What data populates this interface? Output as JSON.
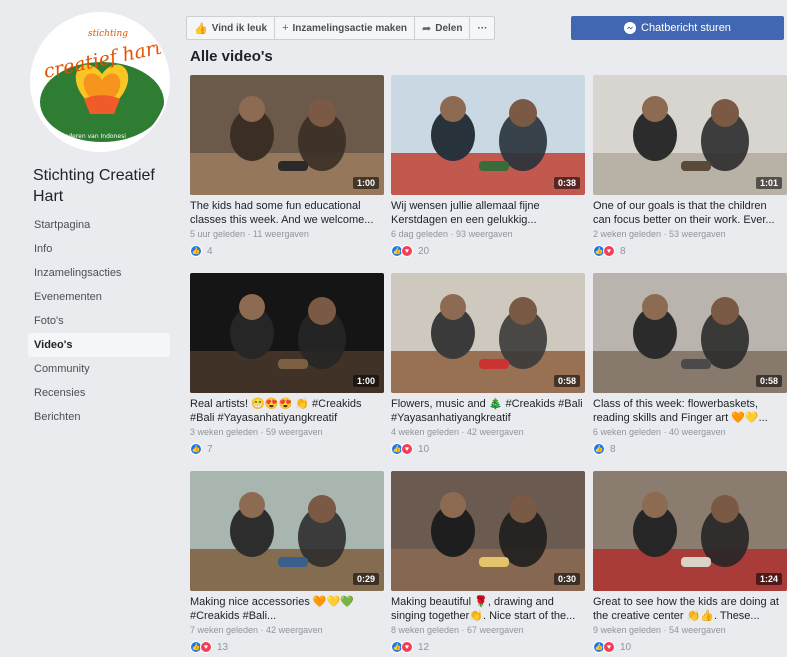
{
  "page": {
    "logo_text_top": "stichting",
    "logo_text_main": "creatief hart",
    "logo_text_bottom": "de kinderen van Indonesi",
    "name": "Stichting Creatief Hart"
  },
  "sidebar": {
    "items": [
      {
        "label": "Startpagina",
        "active": false
      },
      {
        "label": "Info",
        "active": false
      },
      {
        "label": "Inzamelingsacties",
        "active": false
      },
      {
        "label": "Evenementen",
        "active": false
      },
      {
        "label": "Foto's",
        "active": false
      },
      {
        "label": "Video's",
        "active": true
      },
      {
        "label": "Community",
        "active": false
      },
      {
        "label": "Recensies",
        "active": false
      },
      {
        "label": "Berichten",
        "active": false
      }
    ]
  },
  "actions": {
    "like": "Vind ik leuk",
    "fundraiser": "Inzamelingsactie maken",
    "share": "Delen",
    "more": "···",
    "message": "Chatbericht sturen"
  },
  "section_title": "Alle video's",
  "colors": {
    "accent": "#4267b2",
    "like": "#1877f2",
    "love": "#f33e58"
  },
  "videos": [
    {
      "duration": "1:00",
      "title": "The kids had some fun educational classes this week. And we welcome...",
      "meta": "5 uur geleden · 11 weergaven",
      "reactions": [
        "like"
      ],
      "count": "4"
    },
    {
      "duration": "0:38",
      "title": "Wij wensen jullie allemaal fijne Kerstdagen en een gelukkig...",
      "meta": "6 dag geleden · 93 weergaven",
      "reactions": [
        "like",
        "love"
      ],
      "count": "20"
    },
    {
      "duration": "1:01",
      "title": "One of our goals is that the children can focus better on their work. Ever...",
      "meta": "2 weken geleden · 53 weergaven",
      "reactions": [
        "like",
        "love"
      ],
      "count": "8"
    },
    {
      "duration": "1:00",
      "title": "Real artists! 😁😍😍 👏 #Creakids #Bali #Yayasanhatiyangkreatif",
      "meta": "3 weken geleden · 59 weergaven",
      "reactions": [
        "like"
      ],
      "count": "7"
    },
    {
      "duration": "0:58",
      "title": "Flowers, music and 🎄 #Creakids #Bali #Yayasanhatiyangkreatif",
      "meta": "4 weken geleden · 42 weergaven",
      "reactions": [
        "like",
        "love"
      ],
      "count": "10"
    },
    {
      "duration": "0:58",
      "title": "Class of this week: flowerbaskets, reading skills and Finger art 🧡💛...",
      "meta": "6 weken geleden · 40 weergaven",
      "reactions": [
        "like"
      ],
      "count": "8"
    },
    {
      "duration": "0:29",
      "title": "Making nice accessories 🧡💛💚 #Creakids #Bali...",
      "meta": "7 weken geleden · 42 weergaven",
      "reactions": [
        "like",
        "love"
      ],
      "count": "13"
    },
    {
      "duration": "0:30",
      "title": "Making beautiful 🌹, drawing and singing together👏. Nice start of the...",
      "meta": "8 weken geleden · 67 weergaven",
      "reactions": [
        "like",
        "love"
      ],
      "count": "12"
    },
    {
      "duration": "1:24",
      "title": "Great to see how the kids are doing at the creative center 👏👍. These...",
      "meta": "9 weken geleden · 54 weergaven",
      "reactions": [
        "like",
        "love"
      ],
      "count": "10"
    }
  ]
}
